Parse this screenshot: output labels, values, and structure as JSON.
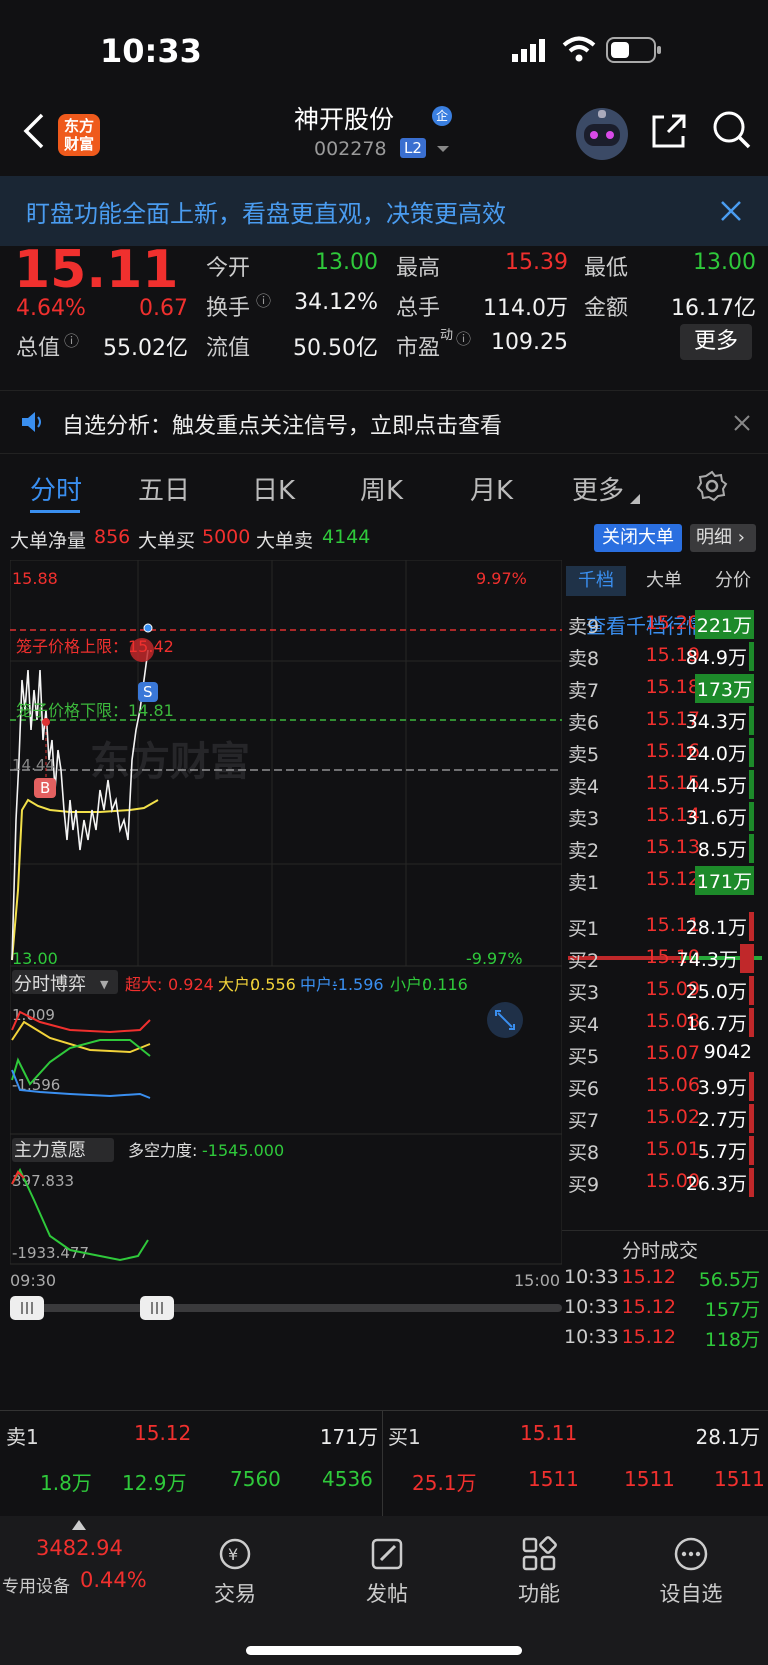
{
  "status": {
    "time": "10:33"
  },
  "header": {
    "logo_text": "东方财富",
    "stock_name": "神开股份",
    "badge": "企",
    "code": "002278",
    "level": "L2"
  },
  "banner": {
    "text": "盯盘功能全面上新，看盘更直观，决策更高效"
  },
  "quote": {
    "price": "15.11",
    "pct": "4.64%",
    "change": "0.67",
    "open_label": "今开",
    "open": "13.00",
    "high_label": "最高",
    "high": "15.39",
    "low_label": "最低",
    "low": "13.00",
    "turnover_label": "换手",
    "turnover": "34.12%",
    "volume_label": "总手",
    "volume": "114.0万",
    "amount_label": "金额",
    "amount": "16.17亿",
    "mcap_label": "总值",
    "mcap": "55.02亿",
    "float_label": "流值",
    "float": "50.50亿",
    "pe_label": "市盈",
    "pe_sup": "动",
    "pe": "109.25",
    "more": "更多"
  },
  "notice": {
    "text": "自选分析：触发重点关注信号，立即点击查看"
  },
  "tabs": [
    "分时",
    "五日",
    "日K",
    "周K",
    "月K",
    "更多"
  ],
  "bigorder": {
    "net_label": "大单净量",
    "net": "856",
    "buy_label": "大单买",
    "buy": "5000",
    "sell_label": "大单卖",
    "sell": "4144",
    "close_btn": "关闭大单",
    "detail_btn": "明细"
  },
  "chart": {
    "top_price": "15.88",
    "top_pct": "9.97%",
    "bottom_price": "13.00",
    "bottom_pct": "-9.97%",
    "upper_limit": "笼子价格上限：15.42",
    "lower_limit": "笼子价格下限：14.81",
    "mid_price": "14.44",
    "watermark": "东方财富",
    "b_mark": "B",
    "s_mark": "S",
    "game_label": "分时博弈",
    "super_label": "超大:",
    "super": "0.924",
    "big_label": "大户:",
    "big": "0.556",
    "mid_label": "中户:",
    "mid": "-1.596",
    "small_label": "小户:",
    "small": "0.116",
    "game_top": "1.009",
    "game_bottom": "-1.596",
    "will_label": "主力意愿",
    "force_label": "多空力度:",
    "force": "-1545.000",
    "will_top": "397.833",
    "will_bottom": "-1933.477",
    "time_start": "09:30",
    "time_end": "15:00"
  },
  "depth": {
    "tabs": [
      "千档",
      "大单",
      "分价"
    ],
    "link": "查看千档行情 >",
    "asks": [
      [
        "卖9",
        "15.20",
        "221万"
      ],
      [
        "卖8",
        "15.19",
        "84.9万"
      ],
      [
        "卖7",
        "15.18",
        "173万"
      ],
      [
        "卖6",
        "15.17",
        "34.3万"
      ],
      [
        "卖5",
        "15.16",
        "24.0万"
      ],
      [
        "卖4",
        "15.15",
        "44.5万"
      ],
      [
        "卖3",
        "15.14",
        "31.6万"
      ],
      [
        "卖2",
        "15.13",
        "8.5万"
      ],
      [
        "卖1",
        "15.12",
        "171万"
      ]
    ],
    "bids": [
      [
        "买1",
        "15.11",
        "28.1万"
      ],
      [
        "买2",
        "15.10",
        "74.3万"
      ],
      [
        "买3",
        "15.09",
        "25.0万"
      ],
      [
        "买4",
        "15.08",
        "16.7万"
      ],
      [
        "买5",
        "15.07",
        "9042"
      ],
      [
        "买6",
        "15.06",
        "3.9万"
      ],
      [
        "买7",
        "15.02",
        "2.7万"
      ],
      [
        "买8",
        "15.01",
        "5.7万"
      ],
      [
        "买9",
        "15.00",
        "26.3万"
      ]
    ],
    "trades_label": "分时成交",
    "trades": [
      [
        "10:33",
        "15.12",
        "56.5万"
      ],
      [
        "10:33",
        "15.12",
        "157万"
      ],
      [
        "10:33",
        "15.12",
        "118万"
      ]
    ]
  },
  "bottom": {
    "sell_label": "卖1",
    "sell_price": "15.12",
    "sell_vol": "171万",
    "buy_label": "买1",
    "buy_price": "15.11",
    "buy_vol": "28.1万",
    "sell_row": [
      "1.8万",
      "12.9万",
      "7560",
      "4536"
    ],
    "buy_row": [
      "25.1万",
      "1511",
      "1511",
      "1511"
    ]
  },
  "tabbar": {
    "index": "3482.94",
    "device": "专用设备",
    "index_pct": "0.44%",
    "trade": "交易",
    "post": "发帖",
    "func": "功能",
    "watch": "设自选"
  }
}
